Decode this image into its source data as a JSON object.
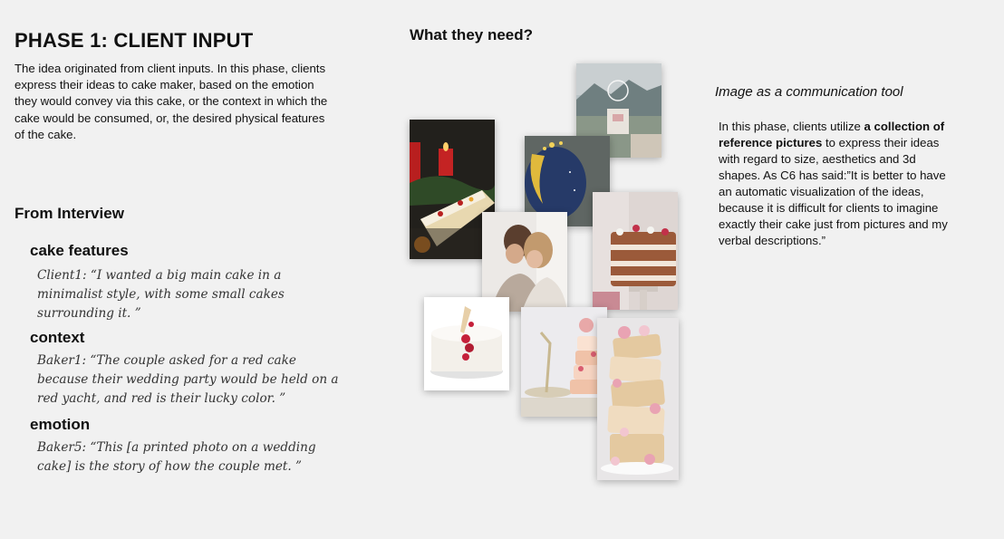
{
  "left": {
    "title": "PHASE 1: CLIENT INPUT",
    "intro": "The idea originated from client inputs. In this phase, clients express their ideas to cake maker, based on the emotion they would convey via this cake, or the context in which the cake would be consumed, or, the desired physical features of the cake.",
    "interview_heading": "From Interview",
    "sections": [
      {
        "heading": "cake features",
        "quote": "Client1: “I wanted a big main cake in a minimalist style, with some small cakes surrounding it. ”"
      },
      {
        "heading": "context",
        "quote": "Baker1: “The couple asked for a red cake because their wedding party would be held on a red yacht, and red is their lucky color. ”"
      },
      {
        "heading": "emotion",
        "quote": "Baker5: “This [a printed photo on a wedding cake] is the story of how the couple met. ”"
      }
    ]
  },
  "middle": {
    "heading": "What they need?"
  },
  "right": {
    "heading": "Image as a communication tool",
    "body_before": "In this phase, clients utilize ",
    "body_bold": "a collection of reference pictures",
    "body_after": " to express their ideas with regard to size, aesthetics and 3d shapes. As C6 has said:”It is better to have an automatic visualization of the ideas, because it is difficult for clients to imagine exactly their cake just from pictures and my verbal descriptions.”"
  },
  "colors": {
    "background": "#f1f1f1",
    "text": "#111111",
    "quote_text": "#333333"
  }
}
